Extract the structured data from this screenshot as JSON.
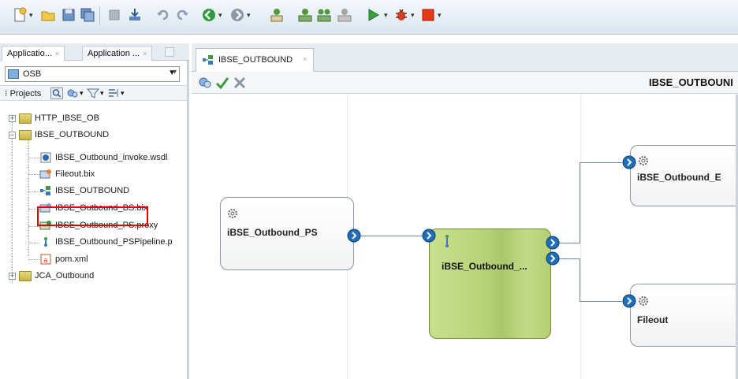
{
  "left_pane": {
    "tabs": [
      {
        "label": "Applicatio...",
        "close": "×"
      },
      {
        "label": "Application ...",
        "close": "×"
      }
    ],
    "application_selector": {
      "value": "OSB"
    },
    "projects_label": "Projects",
    "tree": [
      {
        "label": "HTTP_IBSE_OB"
      },
      {
        "label": "IBSE_OUTBOUND"
      },
      {
        "label": "IBSE_Outbound_invoke.wsdl"
      },
      {
        "label": "Fileout.bix"
      },
      {
        "label": "IBSE_OUTBOUND"
      },
      {
        "label": "IBSE_Outbound_BS.bix"
      },
      {
        "label": "IBSE_Outbound_PS.proxy"
      },
      {
        "label": "IBSE_Outbound_PSPipeline.p"
      },
      {
        "label": "pom.xml"
      },
      {
        "label": "JCA_Outbound"
      }
    ]
  },
  "editor": {
    "tab": {
      "label": "IBSE_OUTBOUND",
      "close": "×"
    },
    "toolbar_title": "IBSE_OUTBOUNI",
    "components": {
      "proxy": {
        "name": "iBSE_Outbound_PS"
      },
      "pipeline": {
        "name": "iBSE_Outbound_..."
      },
      "business": {
        "name": "iBSE_Outbound_E"
      },
      "fileout": {
        "name": "Fileout"
      }
    }
  },
  "colors": {
    "accent_green": "#b7d377",
    "port_blue": "#1f6fb8",
    "highlight_red": "#e00000"
  }
}
